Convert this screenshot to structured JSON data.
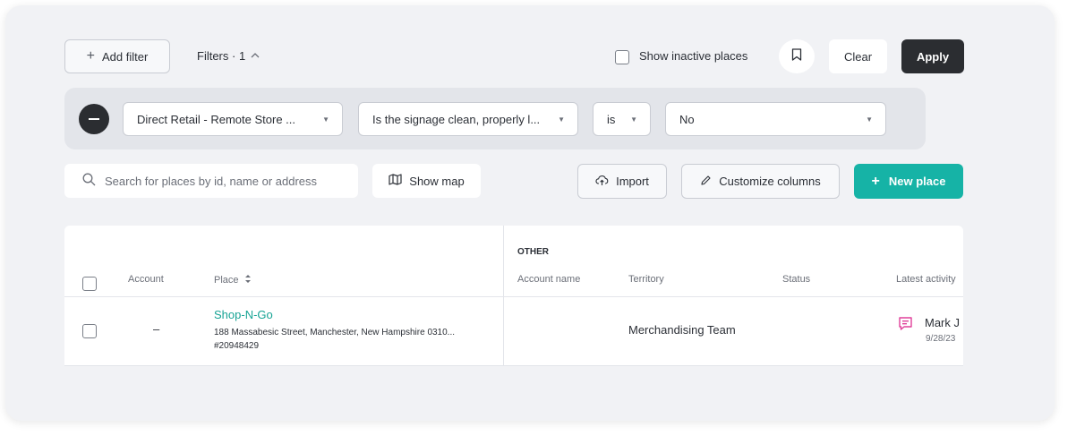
{
  "toolbar": {
    "add_filter_label": "Add filter",
    "filters_label": "Filters · 1",
    "show_inactive_label": "Show inactive places",
    "clear_label": "Clear",
    "apply_label": "Apply"
  },
  "filter_row": {
    "field_value": "Direct Retail - Remote Store ...",
    "question_value": "Is the signage clean, properly l...",
    "operator_value": "is",
    "answer_value": "No"
  },
  "search": {
    "placeholder": "Search for places by id, name or address"
  },
  "actions": {
    "show_map_label": "Show map",
    "import_label": "Import",
    "customize_columns_label": "Customize columns",
    "new_place_label": "New place"
  },
  "table": {
    "group_header": "OTHER",
    "columns": {
      "account": "Account",
      "place": "Place",
      "account_name": "Account name",
      "territory": "Territory",
      "status": "Status",
      "latest_activity": "Latest activity"
    },
    "rows": [
      {
        "account": "–",
        "place_name": "Shop-N-Go",
        "place_address": "188 Massabesic Street, Manchester, New Hampshire 0310...",
        "place_id": "#20948429",
        "account_name": "",
        "territory": "Merchandising Team",
        "status": "",
        "activity_user": "Mark J",
        "activity_date": "9/28/23"
      }
    ]
  },
  "colors": {
    "accent_teal": "#16b3a6",
    "apply_dark": "#2b2d31",
    "activity_icon": "#e0409a"
  }
}
